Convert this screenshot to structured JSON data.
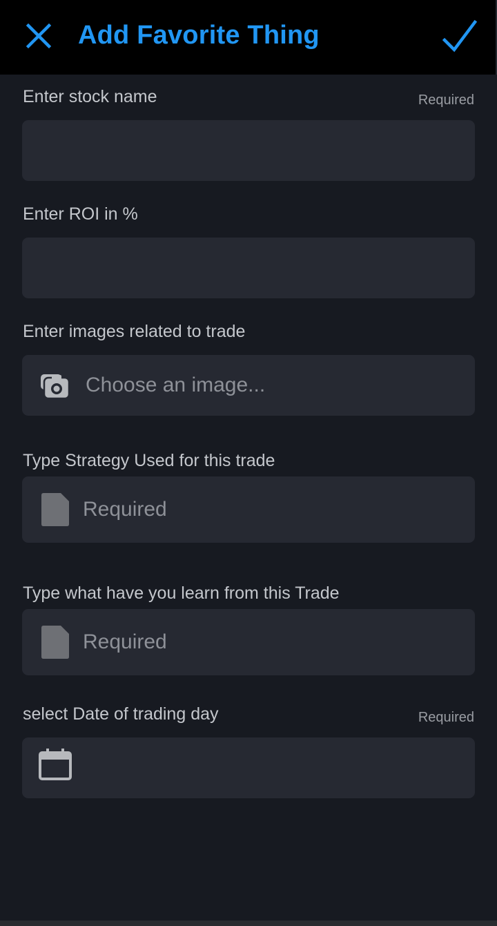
{
  "header": {
    "title": "Add Favorite Thing",
    "accent_color": "#2196f3",
    "close_icon": "close-icon",
    "confirm_icon": "check-icon"
  },
  "form": {
    "stock_name": {
      "label": "Enter stock name",
      "required_note": "Required",
      "value": ""
    },
    "roi": {
      "label": "Enter ROI in %",
      "value": ""
    },
    "images": {
      "label": "Enter images related to trade",
      "placeholder": "Choose an image...",
      "icon": "camera-icon"
    },
    "strategy": {
      "label": "Type Strategy Used for this trade",
      "placeholder": "Required",
      "icon": "document-icon"
    },
    "learned": {
      "label": "Type what have you learn from this Trade",
      "placeholder": "Required",
      "icon": "document-icon"
    },
    "date": {
      "label": "select Date of trading day",
      "required_note": "Required",
      "icon": "calendar-icon",
      "value": ""
    }
  }
}
